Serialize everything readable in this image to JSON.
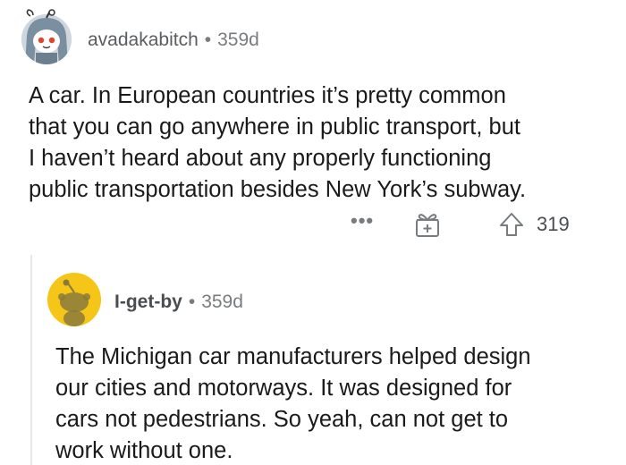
{
  "top_comment": {
    "username": "avadakabitch",
    "separator": "•",
    "age": "359d",
    "body_lines": [
      "A car. In European countries it’s pretty common",
      "that you can go anywhere in public transport, but",
      "I haven’t heard about any properly functioning",
      "public transportation besides New York’s subway."
    ],
    "actions": {
      "more_label": "•••",
      "gift_icon": "gift-icon",
      "upvote_icon": "upvote-arrow-icon",
      "score": "319"
    }
  },
  "reply": {
    "username": "I-get-by",
    "separator": "•",
    "age": "359d",
    "body_lines": [
      "The Michigan car manufacturers helped design",
      "our cities and motorways. It was designed for",
      "cars not pedestrians. So yeah, can not get to",
      "work without one."
    ]
  },
  "colors": {
    "meta_text": "#787c7e",
    "body_text": "#1a1a1b",
    "reply_avatar_bg": "#f5c518",
    "thread_line": "#e6e7e8"
  }
}
